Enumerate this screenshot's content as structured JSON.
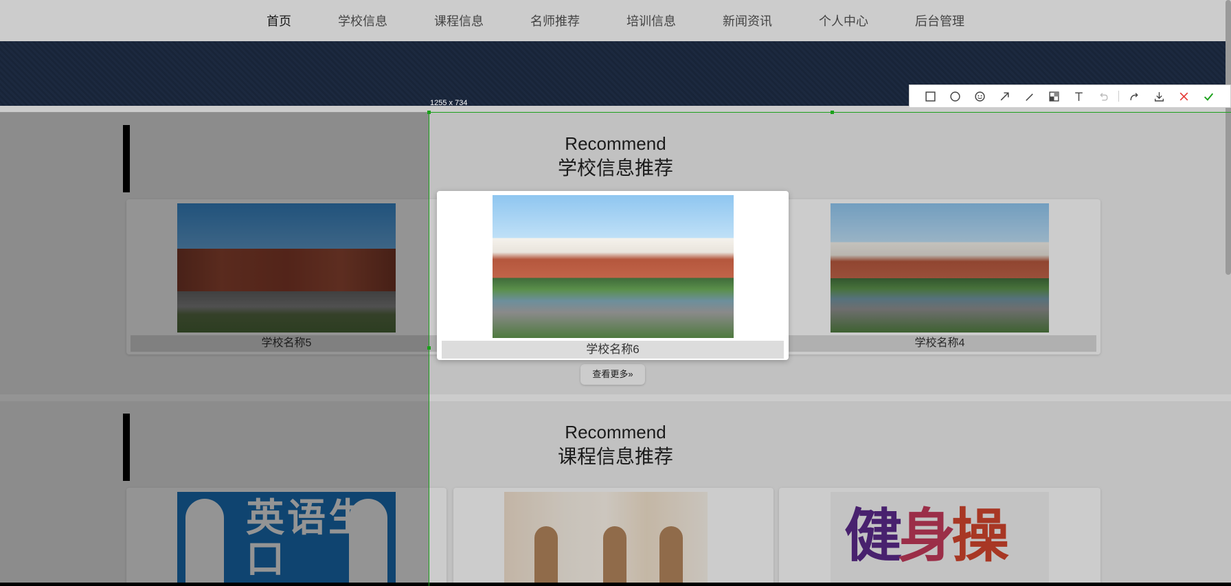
{
  "nav": {
    "items": [
      "首页",
      "学校信息",
      "课程信息",
      "名师推荐",
      "培训信息",
      "新闻资讯",
      "个人中心",
      "后台管理"
    ]
  },
  "school_section": {
    "title_en": "Recommend",
    "title_cn": "学校信息推荐",
    "cards": [
      {
        "name": "学校名称5"
      },
      {
        "name": "学校名称6"
      },
      {
        "name": "学校名称4"
      }
    ],
    "more_label": "查看更多»"
  },
  "course_section": {
    "title_en": "Recommend",
    "title_cn": "课程信息推荐",
    "english_image_text": "英语生口"
  },
  "screenshot_tool": {
    "size_label": "1255 x 734",
    "tools": [
      "rectangle-icon",
      "circle-icon",
      "emoji-icon",
      "arrow-icon",
      "pen-icon",
      "mosaic-icon",
      "text-icon",
      "undo-icon",
      "redo-icon",
      "download-icon",
      "cancel-icon",
      "confirm-icon"
    ],
    "accent_color": "#1aa11a",
    "cancel_color": "#e53935"
  }
}
